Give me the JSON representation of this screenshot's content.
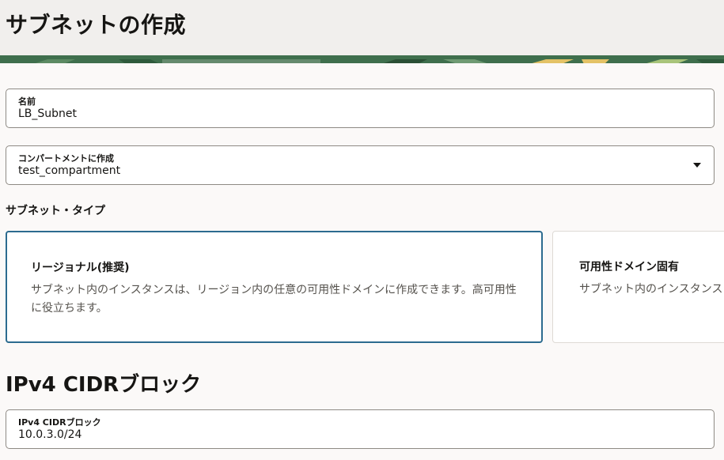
{
  "page": {
    "title": "サブネットの作成"
  },
  "form": {
    "name": {
      "label": "名前",
      "value": "LB_Subnet"
    },
    "compartment": {
      "label": "コンパートメントに作成",
      "value": "test_compartment"
    },
    "subnet_type": {
      "label": "サブネット・タイプ",
      "options": [
        {
          "title": "リージョナル(推奨)",
          "description": "サブネット内のインスタンスは、リージョン内の任意の可用性ドメインに作成できます。高可用性に役立ちます。",
          "selected": true
        },
        {
          "title": "可用性ドメイン固有",
          "description": "サブネット内のインスタンスは、ます。",
          "selected": false
        }
      ]
    },
    "cidr_section": {
      "heading": "IPv4 CIDRブロック",
      "field": {
        "label": "IPv4 CIDRブロック",
        "value": "10.0.3.0/24"
      }
    }
  },
  "colors": {
    "selected_border": "#2c6b8f",
    "banner_green": "#3f6f4d",
    "banner_yellow": "#e3c266"
  }
}
